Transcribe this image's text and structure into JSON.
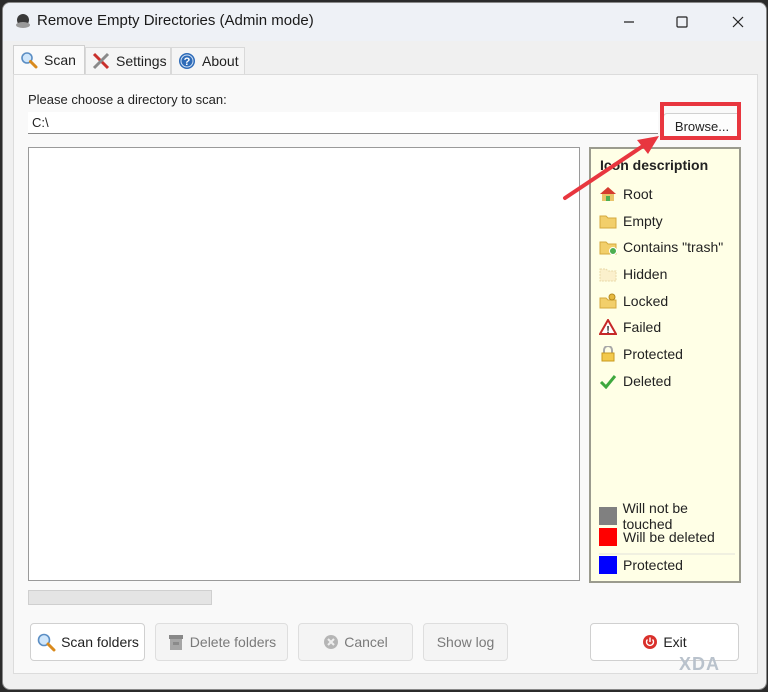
{
  "window": {
    "title": "Remove Empty Directories (Admin mode)",
    "controls": {
      "minimize": "minimize-icon",
      "maximize": "maximize-icon",
      "close": "close-icon"
    }
  },
  "tabs": [
    {
      "label": "Scan",
      "icon": "magnifier-icon",
      "active": true
    },
    {
      "label": "Settings",
      "icon": "tools-icon",
      "active": false
    },
    {
      "label": "About",
      "icon": "help-icon",
      "active": false
    }
  ],
  "scan": {
    "directory_label": "Please choose a directory to scan:",
    "directory_value": "C:\\",
    "browse_label": "Browse...",
    "progress": 0
  },
  "legend": {
    "title": "Icon description",
    "items": [
      {
        "label": "Root",
        "icon": "home-folder-icon"
      },
      {
        "label": "Empty",
        "icon": "empty-folder-icon"
      },
      {
        "label": "Contains \"trash\"",
        "icon": "trash-folder-icon"
      },
      {
        "label": "Hidden",
        "icon": "hidden-folder-icon"
      },
      {
        "label": "Locked",
        "icon": "locked-folder-icon"
      },
      {
        "label": "Failed",
        "icon": "warning-icon"
      },
      {
        "label": "Protected",
        "icon": "padlock-icon"
      },
      {
        "label": "Deleted",
        "icon": "checkmark-icon"
      }
    ],
    "colors": [
      {
        "label": "Will not be touched",
        "color": "#808080"
      },
      {
        "label": "Will be deleted",
        "color": "#ff0000"
      },
      {
        "label": "Protected",
        "color": "#0000ff"
      }
    ]
  },
  "buttons": {
    "scan": "Scan folders",
    "delete": "Delete folders",
    "cancel": "Cancel",
    "show_log": "Show log",
    "exit": "Exit"
  },
  "watermark": "XDA",
  "annotation_color": "#e8363f"
}
